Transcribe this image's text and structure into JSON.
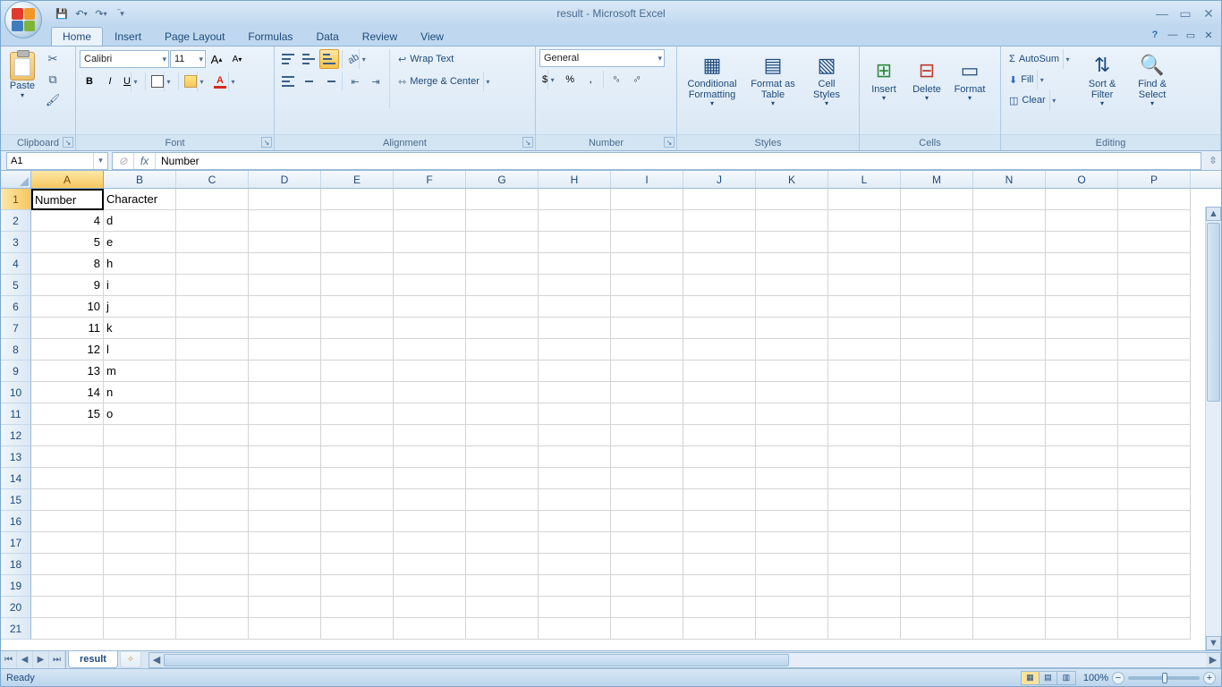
{
  "title": "result - Microsoft Excel",
  "qat": {
    "save": "💾",
    "undo": "↶",
    "redo": "↷"
  },
  "tabs": [
    "Home",
    "Insert",
    "Page Layout",
    "Formulas",
    "Data",
    "Review",
    "View"
  ],
  "activeTab": 0,
  "ribbon": {
    "clipboard": {
      "label": "Clipboard",
      "paste": "Paste"
    },
    "font": {
      "label": "Font",
      "name": "Calibri",
      "size": "11",
      "bold": "B",
      "italic": "I",
      "underline": "U",
      "growA": "A",
      "shrinkA": "A"
    },
    "alignment": {
      "label": "Alignment",
      "wrap": "Wrap Text",
      "merge": "Merge & Center"
    },
    "number": {
      "label": "Number",
      "format": "General",
      "currency": "$",
      "percent": "%",
      "comma": ",",
      "inc": "←.0\n.00",
      "dec": ".00\n→.0"
    },
    "styles": {
      "label": "Styles",
      "cond": "Conditional Formatting",
      "table": "Format as Table",
      "cell": "Cell Styles"
    },
    "cells": {
      "label": "Cells",
      "insert": "Insert",
      "delete": "Delete",
      "format": "Format"
    },
    "editing": {
      "label": "Editing",
      "autosum": "AutoSum",
      "fill": "Fill",
      "clear": "Clear",
      "sort": "Sort & Filter",
      "find": "Find & Select"
    }
  },
  "nameBox": "A1",
  "formula": "Number",
  "columns": [
    "A",
    "B",
    "C",
    "D",
    "E",
    "F",
    "G",
    "H",
    "I",
    "J",
    "K",
    "L",
    "M",
    "N",
    "O",
    "P"
  ],
  "rows": 21,
  "activeCell": {
    "r": 1,
    "c": 1
  },
  "data": {
    "1": {
      "A": "Number",
      "B": "Character"
    },
    "2": {
      "A": "4",
      "B": "d"
    },
    "3": {
      "A": "5",
      "B": "e"
    },
    "4": {
      "A": "8",
      "B": "h"
    },
    "5": {
      "A": "9",
      "B": "i"
    },
    "6": {
      "A": "10",
      "B": "j"
    },
    "7": {
      "A": "11",
      "B": "k"
    },
    "8": {
      "A": "12",
      "B": "l"
    },
    "9": {
      "A": "13",
      "B": "m"
    },
    "10": {
      "A": "14",
      "B": "n"
    },
    "11": {
      "A": "15",
      "B": "o"
    }
  },
  "numericCols": [
    "A"
  ],
  "sheet": "result",
  "status": "Ready",
  "zoom": "100%"
}
